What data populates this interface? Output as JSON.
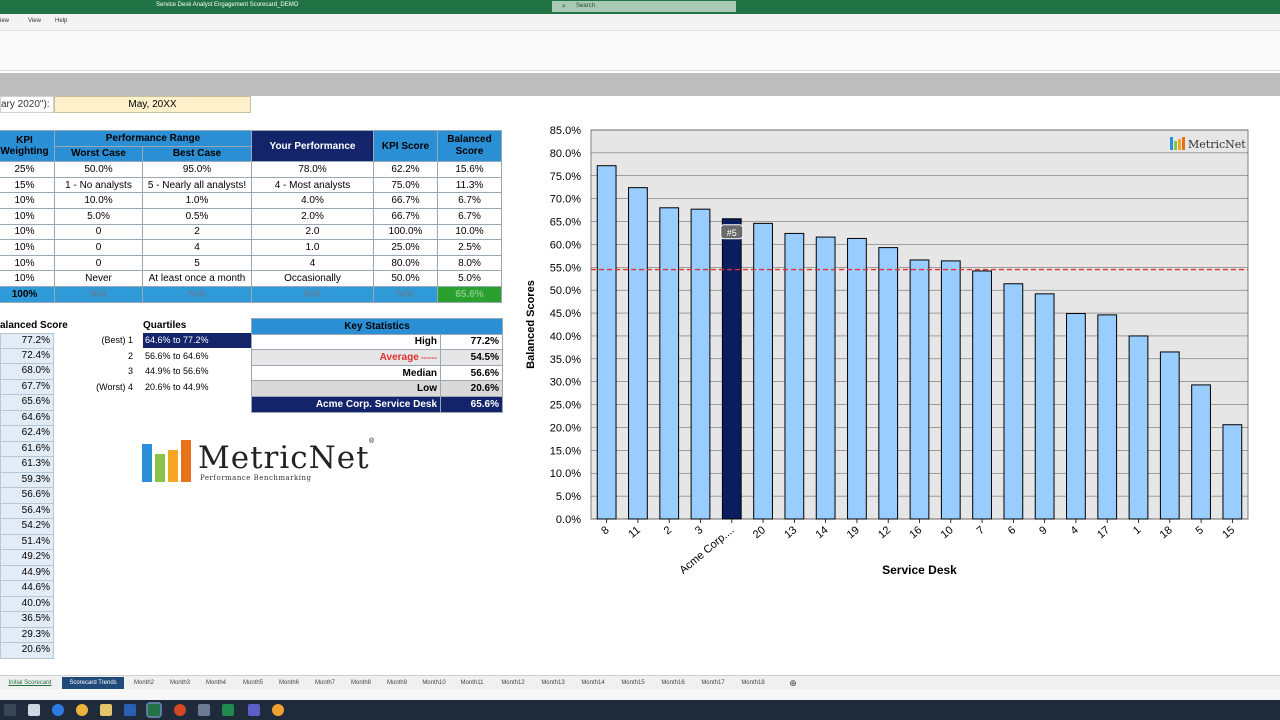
{
  "window": {
    "title": "Service Desk Analyst Engagement Scorecard_DEMO",
    "search_placeholder": "Search"
  },
  "menu": [
    "view",
    "View",
    "Help"
  ],
  "report": {
    "period_label": "ary 2020\"):",
    "month": "May, 20XX"
  },
  "kpi_table": {
    "headers": {
      "weighting": "KPI Weighting",
      "range": "Performance Range",
      "worst": "Worst Case",
      "best": "Best Case",
      "your": "Your Performance",
      "kpi_score": "KPI Score",
      "balanced": "Balanced Score"
    },
    "rows": [
      [
        "25%",
        "50.0%",
        "95.0%",
        "78.0%",
        "62.2%",
        "15.6%"
      ],
      [
        "15%",
        "1 - No analysts",
        "5 - Nearly all analysts!",
        "4 - Most analysts",
        "75.0%",
        "11.3%"
      ],
      [
        "10%",
        "10.0%",
        "1.0%",
        "4.0%",
        "66.7%",
        "6.7%"
      ],
      [
        "10%",
        "5.0%",
        "0.5%",
        "2.0%",
        "66.7%",
        "6.7%"
      ],
      [
        "10%",
        "0",
        "2",
        "2.0",
        "100.0%",
        "10.0%"
      ],
      [
        "10%",
        "0",
        "4",
        "1.0",
        "25.0%",
        "2.5%"
      ],
      [
        "10%",
        "0",
        "5",
        "4",
        "80.0%",
        "8.0%"
      ],
      [
        "10%",
        "Never",
        "At least once a month",
        "Occasionally",
        "50.0%",
        "5.0%"
      ]
    ],
    "total": [
      "100%",
      "N/A",
      "N/A",
      "N/A",
      "N/A",
      "65.6%"
    ]
  },
  "balanced_list": {
    "header": "alanced Score",
    "values": [
      "77.2%",
      "72.4%",
      "68.0%",
      "67.7%",
      "65.6%",
      "64.6%",
      "62.4%",
      "61.6%",
      "61.3%",
      "59.3%",
      "56.6%",
      "56.4%",
      "54.2%",
      "51.4%",
      "49.2%",
      "44.9%",
      "44.6%",
      "40.0%",
      "36.5%",
      "29.3%",
      "20.6%"
    ]
  },
  "quartiles": {
    "header": "Quartiles",
    "rows": [
      {
        "label": "(Best) 1",
        "range": "64.6% to 77.2%"
      },
      {
        "label": "2",
        "range": "56.6% to 64.6%"
      },
      {
        "label": "3",
        "range": "44.9% to 56.6%"
      },
      {
        "label": "(Worst) 4",
        "range": "20.6% to 44.9%"
      }
    ]
  },
  "key_stats": {
    "header": "Key Statistics",
    "rows": [
      {
        "label": "High",
        "value": "77.2%"
      },
      {
        "label": "Average",
        "value": "54.5%"
      },
      {
        "label": "Median",
        "value": "56.6%"
      },
      {
        "label": "Low",
        "value": "20.6%"
      },
      {
        "label": "Acme Corp. Service Desk",
        "value": "65.6%"
      }
    ]
  },
  "logo": {
    "name": "MetricNet",
    "tagline": "Performance Benchmarking",
    "reg": "®"
  },
  "chart_data": {
    "type": "bar",
    "xlabel": "Service Desk",
    "ylabel": "Balanced Scores",
    "ylim": [
      0,
      85
    ],
    "y_ticks": [
      "0.0%",
      "5.0%",
      "10.0%",
      "15.0%",
      "20.0%",
      "25.0%",
      "30.0%",
      "35.0%",
      "40.0%",
      "45.0%",
      "50.0%",
      "55.0%",
      "60.0%",
      "65.0%",
      "70.0%",
      "75.0%",
      "80.0%",
      "85.0%"
    ],
    "categories": [
      "8",
      "11",
      "2",
      "3",
      "Acme Corp....",
      "20",
      "13",
      "14",
      "19",
      "12",
      "16",
      "10",
      "7",
      "6",
      "9",
      "4",
      "17",
      "1",
      "18",
      "5",
      "15"
    ],
    "values": [
      77.2,
      72.4,
      68.0,
      67.7,
      65.6,
      64.6,
      62.4,
      61.6,
      61.3,
      59.3,
      56.6,
      56.4,
      54.2,
      51.4,
      49.2,
      44.9,
      44.6,
      40.0,
      36.5,
      29.3,
      20.6
    ],
    "highlight_index": 4,
    "highlight_label": "#5",
    "average": 54.5,
    "watermark": "MetricNet",
    "colors": {
      "bar": "#99ccff",
      "highlight": "#0a1d5e",
      "average": "#e03030",
      "plot_bg": "#e6e6e6"
    },
    "grid": true
  },
  "sheet_tabs": [
    "Initial Scorecard",
    "Scorecard Trends",
    "Month2",
    "Month3",
    "Month4",
    "Month5",
    "Month6",
    "Month7",
    "Month8",
    "Month9",
    "Month10",
    "Month11",
    "Month12",
    "Month13",
    "Month14",
    "Month15",
    "Month16",
    "Month17",
    "Month18"
  ],
  "colors": {
    "excel_green": "#217346",
    "header_blue": "#2b8fd6",
    "dark_navy": "#13246b"
  }
}
